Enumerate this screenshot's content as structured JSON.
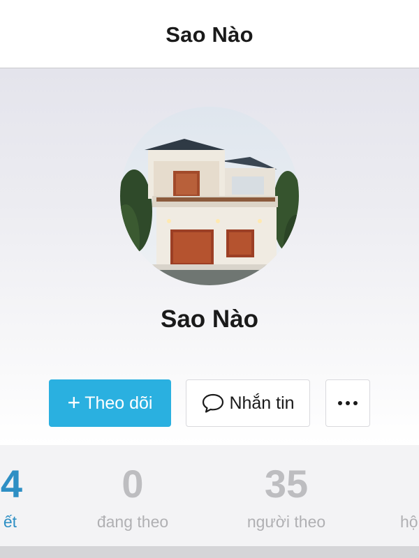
{
  "header": {
    "title": "Sao Nào"
  },
  "profile": {
    "name": "Sao Nào",
    "avatar_icon": "house-photo-avatar"
  },
  "actions": {
    "follow_label": "Theo dõi",
    "follow_icon": "plus-icon",
    "message_label": "Nhắn tin",
    "message_icon": "chat-bubble-icon",
    "more_icon": "more-dots-icon"
  },
  "stats": [
    {
      "value": "4",
      "label": "ết"
    },
    {
      "value": "0",
      "label": "đang theo"
    },
    {
      "value": "35",
      "label": "người theo"
    },
    {
      "value": "",
      "label": "hộ"
    }
  ],
  "colors": {
    "accent": "#2ab0e0",
    "active_stat": "#2e8fc4",
    "inactive_stat": "#bdbdc0",
    "title_text": "#1a1a1a"
  }
}
